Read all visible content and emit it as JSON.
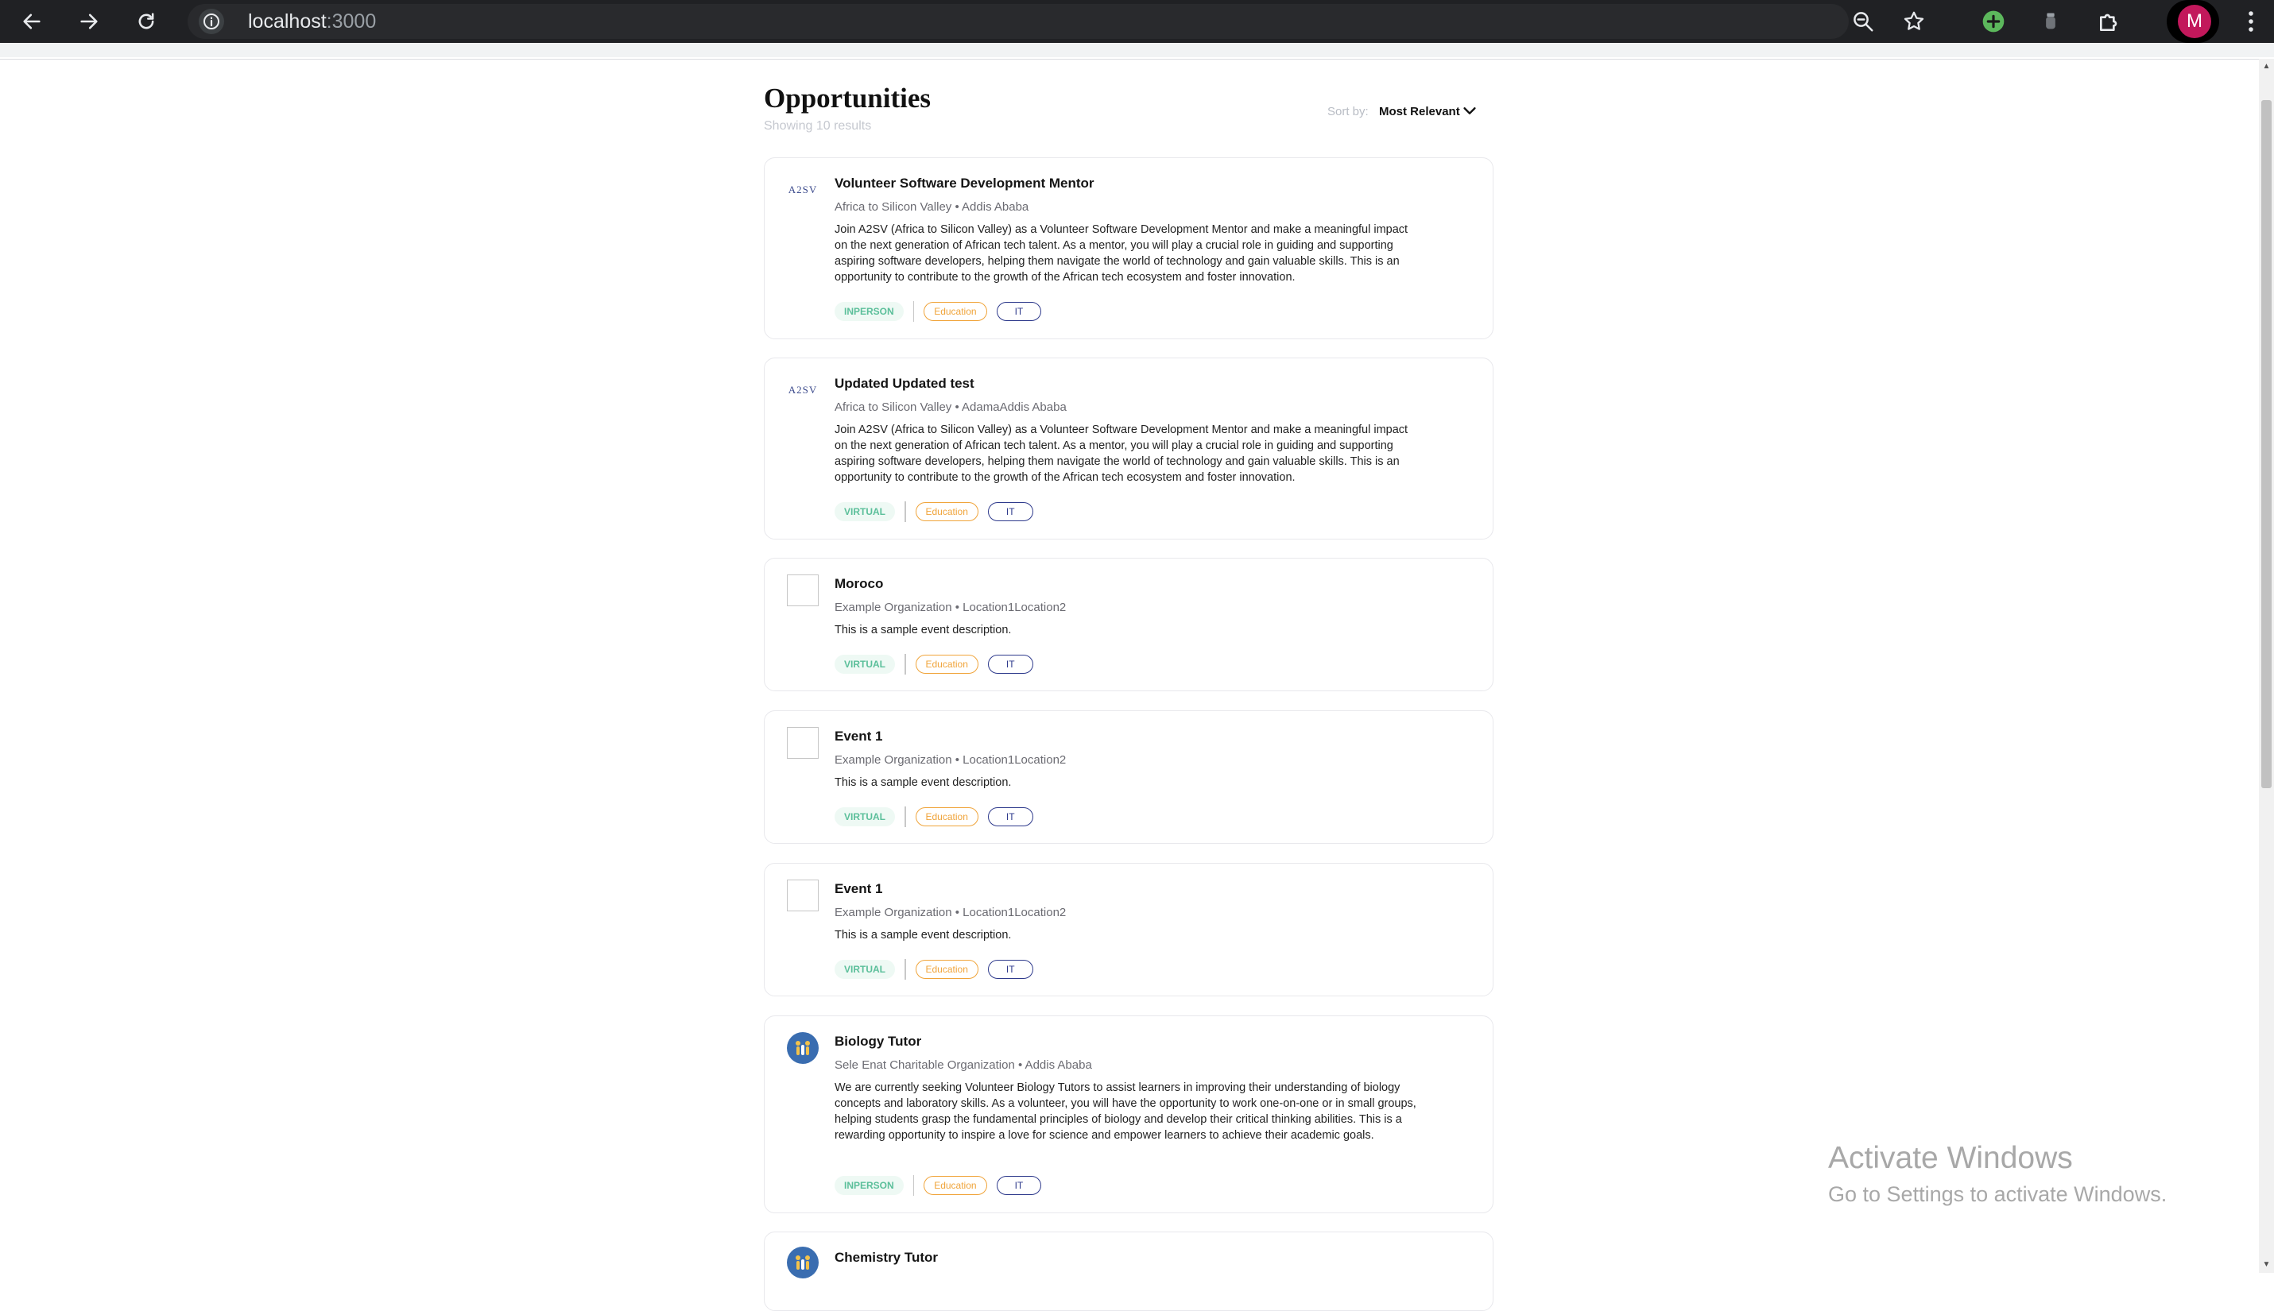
{
  "browser": {
    "url_host": "localhost",
    "url_port": ":3000",
    "profile_initial": "M"
  },
  "header": {
    "title": "Opportunities",
    "result_count": "Showing 10 results",
    "sort_label": "Sort by:",
    "sort_value": "Most Relevant"
  },
  "cards": [
    {
      "logo": "a2sv-logo",
      "logo_text": "A2SV",
      "title": "Volunteer Software Development Mentor",
      "meta": "Africa to Silicon Valley • Addis Ababa",
      "description": "Join A2SV (Africa to Silicon Valley) as a Volunteer Software Development Mentor and make a meaningful impact on the next generation of African tech talent. As a mentor, you will play a crucial role in guiding and supporting aspiring software developers, helping them navigate the world of technology and gain valuable skills. This is an opportunity to contribute to the growth of the African tech ecosystem and foster innovation.",
      "type": "INPERSON",
      "category": "Education",
      "field": "IT"
    },
    {
      "logo": "a2sv-logo",
      "logo_text": "A2SV",
      "title": "Updated Updated test",
      "meta": "Africa to Silicon Valley • AdamaAddis Ababa",
      "description": "Join A2SV (Africa to Silicon Valley) as a Volunteer Software Development Mentor and make a meaningful impact on the next generation of African tech talent. As a mentor, you will play a crucial role in guiding and supporting aspiring software developers, helping them navigate the world of technology and gain valuable skills. This is an opportunity to contribute to the growth of the African tech ecosystem and foster innovation.",
      "type": "VIRTUAL",
      "category": "Education",
      "field": "IT"
    },
    {
      "logo": "broken-image-icon",
      "title": "Moroco",
      "meta": "Example Organization • Location1Location2",
      "description": "This is a sample event description.",
      "type": "VIRTUAL",
      "category": "Education",
      "field": "IT"
    },
    {
      "logo": "broken-image-icon",
      "title": "Event 1",
      "meta": "Example Organization • Location1Location2",
      "description": "This is a sample event description.",
      "type": "VIRTUAL",
      "category": "Education",
      "field": "IT"
    },
    {
      "logo": "broken-image-icon",
      "title": "Event 1",
      "meta": "Example Organization • Location1Location2",
      "description": "This is a sample event description.",
      "type": "VIRTUAL",
      "category": "Education",
      "field": "IT"
    },
    {
      "logo": "charity-logo",
      "title": "Biology Tutor",
      "meta": "Sele Enat Charitable Organization • Addis Ababa",
      "description": "We are currently seeking Volunteer Biology Tutors to assist learners in improving their understanding of biology concepts and laboratory skills. As a volunteer, you will have the opportunity to work one-on-one or in small groups, helping students grasp the fundamental principles of biology and develop their critical thinking abilities. This is a rewarding opportunity to inspire a love for science and empower learners to achieve their academic goals.",
      "type": "INPERSON",
      "category": "Education",
      "field": "IT"
    },
    {
      "logo": "charity-logo",
      "title": "Chemistry Tutor"
    }
  ],
  "watermark": {
    "line1": "Activate Windows",
    "line2": "Go to Settings to activate Windows."
  }
}
